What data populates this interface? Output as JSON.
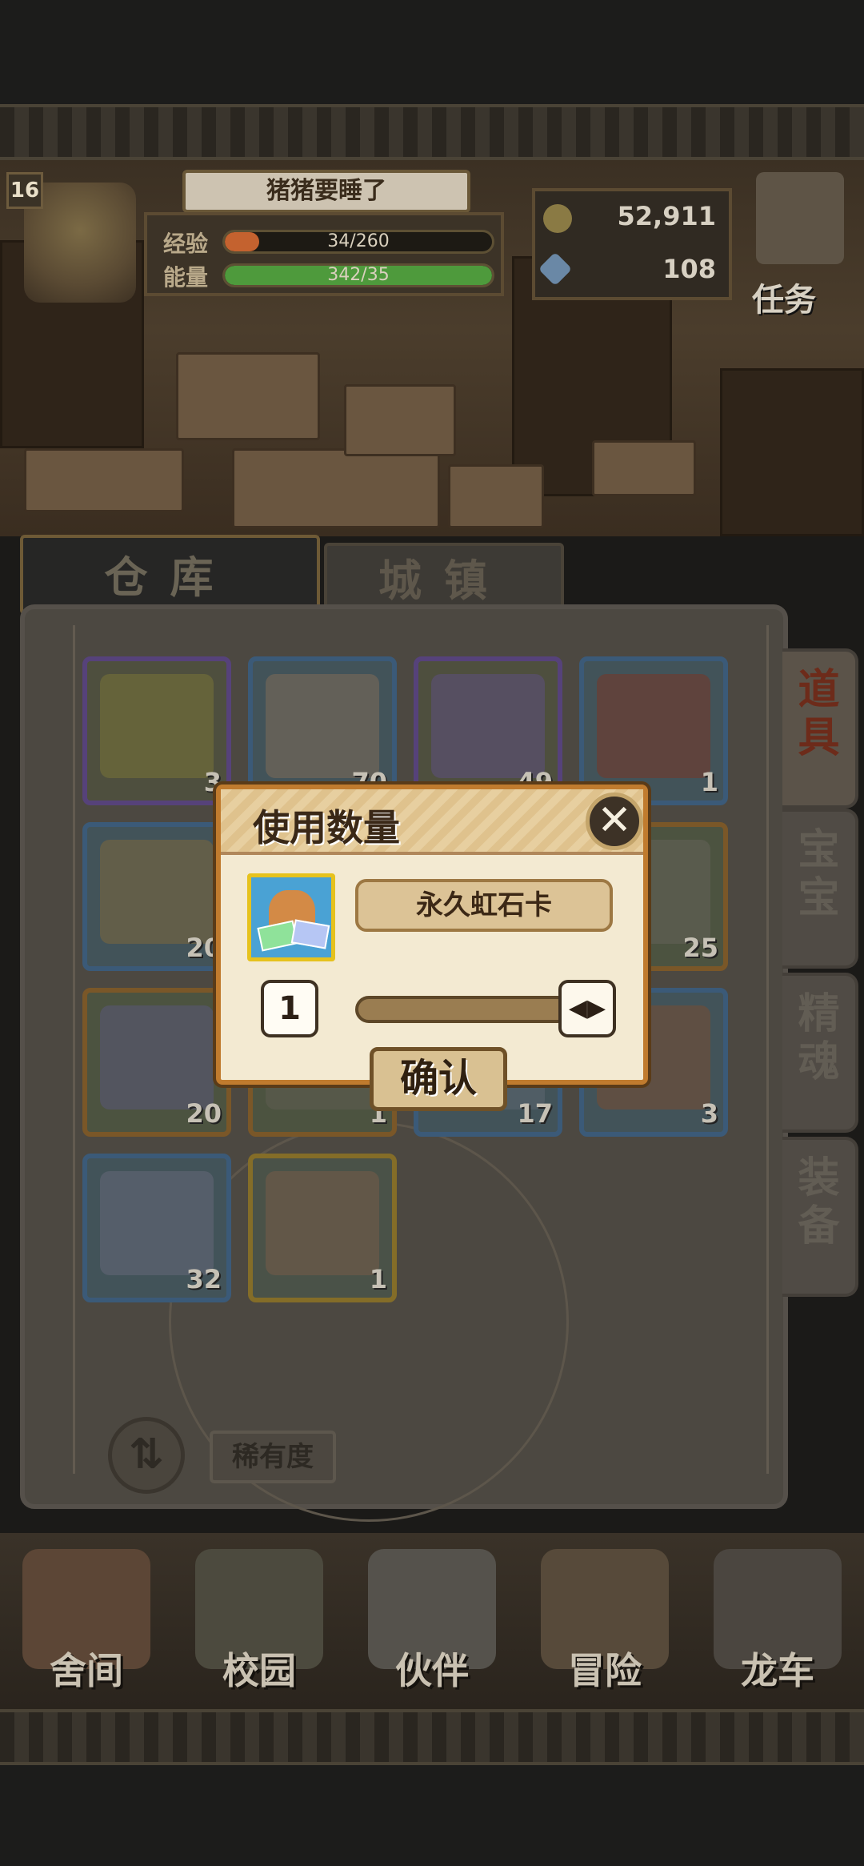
{
  "player": {
    "level": "16",
    "name": "猪猪要睡了",
    "exp_label": "经验",
    "exp_text": "34/260",
    "exp_fraction": 0.13,
    "energy_label": "能量",
    "energy_text": "342/35",
    "energy_fraction": 1.0
  },
  "currency": {
    "gold": "52,911",
    "gems": "108"
  },
  "task_label": "任务",
  "tabs": {
    "warehouse": "仓库",
    "town": "城镇"
  },
  "side_tabs": [
    "道具",
    "宝宝",
    "精魂",
    "装备"
  ],
  "items": [
    {
      "qty": "3",
      "frame": "purple",
      "color": "#6d6a3a"
    },
    {
      "qty": "70",
      "frame": "blue",
      "color": "#6f6458"
    },
    {
      "qty": "49",
      "frame": "purple",
      "color": "#5a4f6e"
    },
    {
      "qty": "1",
      "frame": "blue",
      "color": "#6a3e34"
    },
    {
      "qty": "20",
      "frame": "blue",
      "color": "#6e6244"
    },
    {
      "qty": "",
      "frame": "blue",
      "color": "#4d5a5a"
    },
    {
      "qty": "",
      "frame": "blue",
      "color": "#4d5a5a"
    },
    {
      "qty": "25",
      "frame": "orange",
      "color": "#5e5d52"
    },
    {
      "qty": "20",
      "frame": "orange",
      "color": "#55566a"
    },
    {
      "qty": "1",
      "frame": "orange",
      "color": "#5a5a4c"
    },
    {
      "qty": "17",
      "frame": "blue",
      "color": "#55606a"
    },
    {
      "qty": "3",
      "frame": "blue",
      "color": "#6a4e3c"
    },
    {
      "qty": "32",
      "frame": "blue",
      "color": "#5c6270"
    },
    {
      "qty": "1",
      "frame": "gold",
      "color": "#6b5a48"
    }
  ],
  "sort_icon": "sort-arrows-icon",
  "sort_glyph": "⇅",
  "rarity_label": "稀有度",
  "nav": [
    "舍间",
    "校园",
    "伙伴",
    "冒险",
    "龙车"
  ],
  "dialog": {
    "title": "使用数量",
    "close_glyph": "✕",
    "item_name": "永久虹石卡",
    "quantity": "1",
    "knob_glyph": "◀▶",
    "confirm": "确认"
  },
  "colors": {
    "dialog_border": "#c07b2e",
    "exp_bar": "#c4622f",
    "energy_bar": "#4e9a3c"
  }
}
